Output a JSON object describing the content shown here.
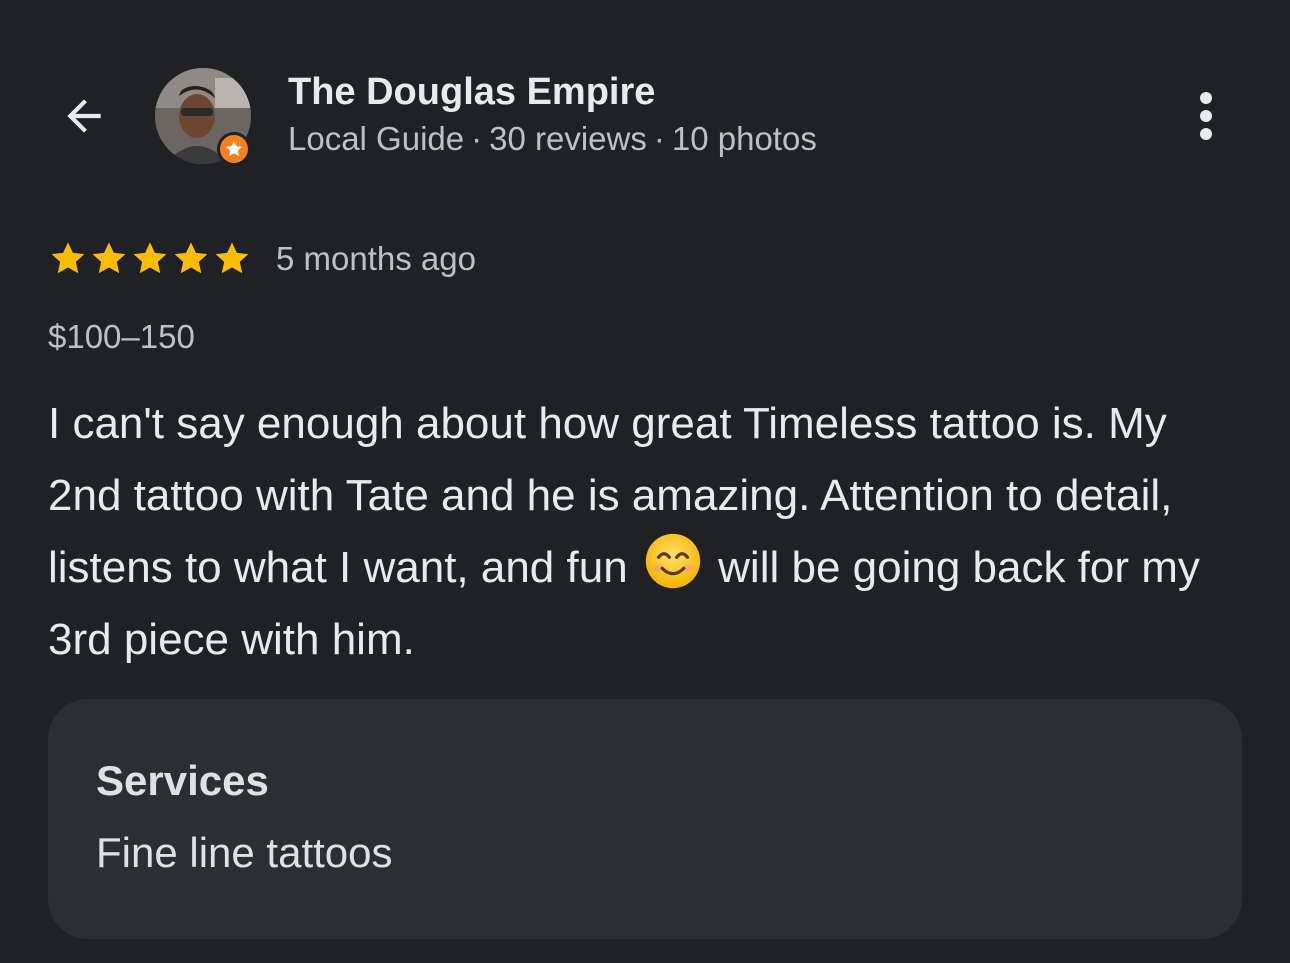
{
  "reviewer": {
    "name": "The Douglas Empire",
    "badge": "Local Guide",
    "separator": "·",
    "reviews": "30 reviews",
    "photos": "10 photos"
  },
  "icons": {
    "back": "arrow-back-icon",
    "more": "more-vert-icon",
    "guide_badge": "star-badge-icon",
    "emoji": "smiling-face-emoji"
  },
  "review": {
    "rating": 5,
    "rating_max": 5,
    "time": "5 months ago",
    "price": "$100–150",
    "text_before_emoji": "I can't say enough about how great Timeless tattoo is. My 2nd tattoo with Tate and he is amazing. Attention to detail, listens to what I want, and fun",
    "text_after_emoji": "will be going back for my 3rd piece with him."
  },
  "services": {
    "title": "Services",
    "value": "Fine line tattoos"
  },
  "colors": {
    "background": "#202124",
    "card": "#2d2e31",
    "star": "#fbbc04",
    "badge": "#f4801f",
    "primary_text": "#e8eaed",
    "secondary_text": "#bdc1c6"
  }
}
